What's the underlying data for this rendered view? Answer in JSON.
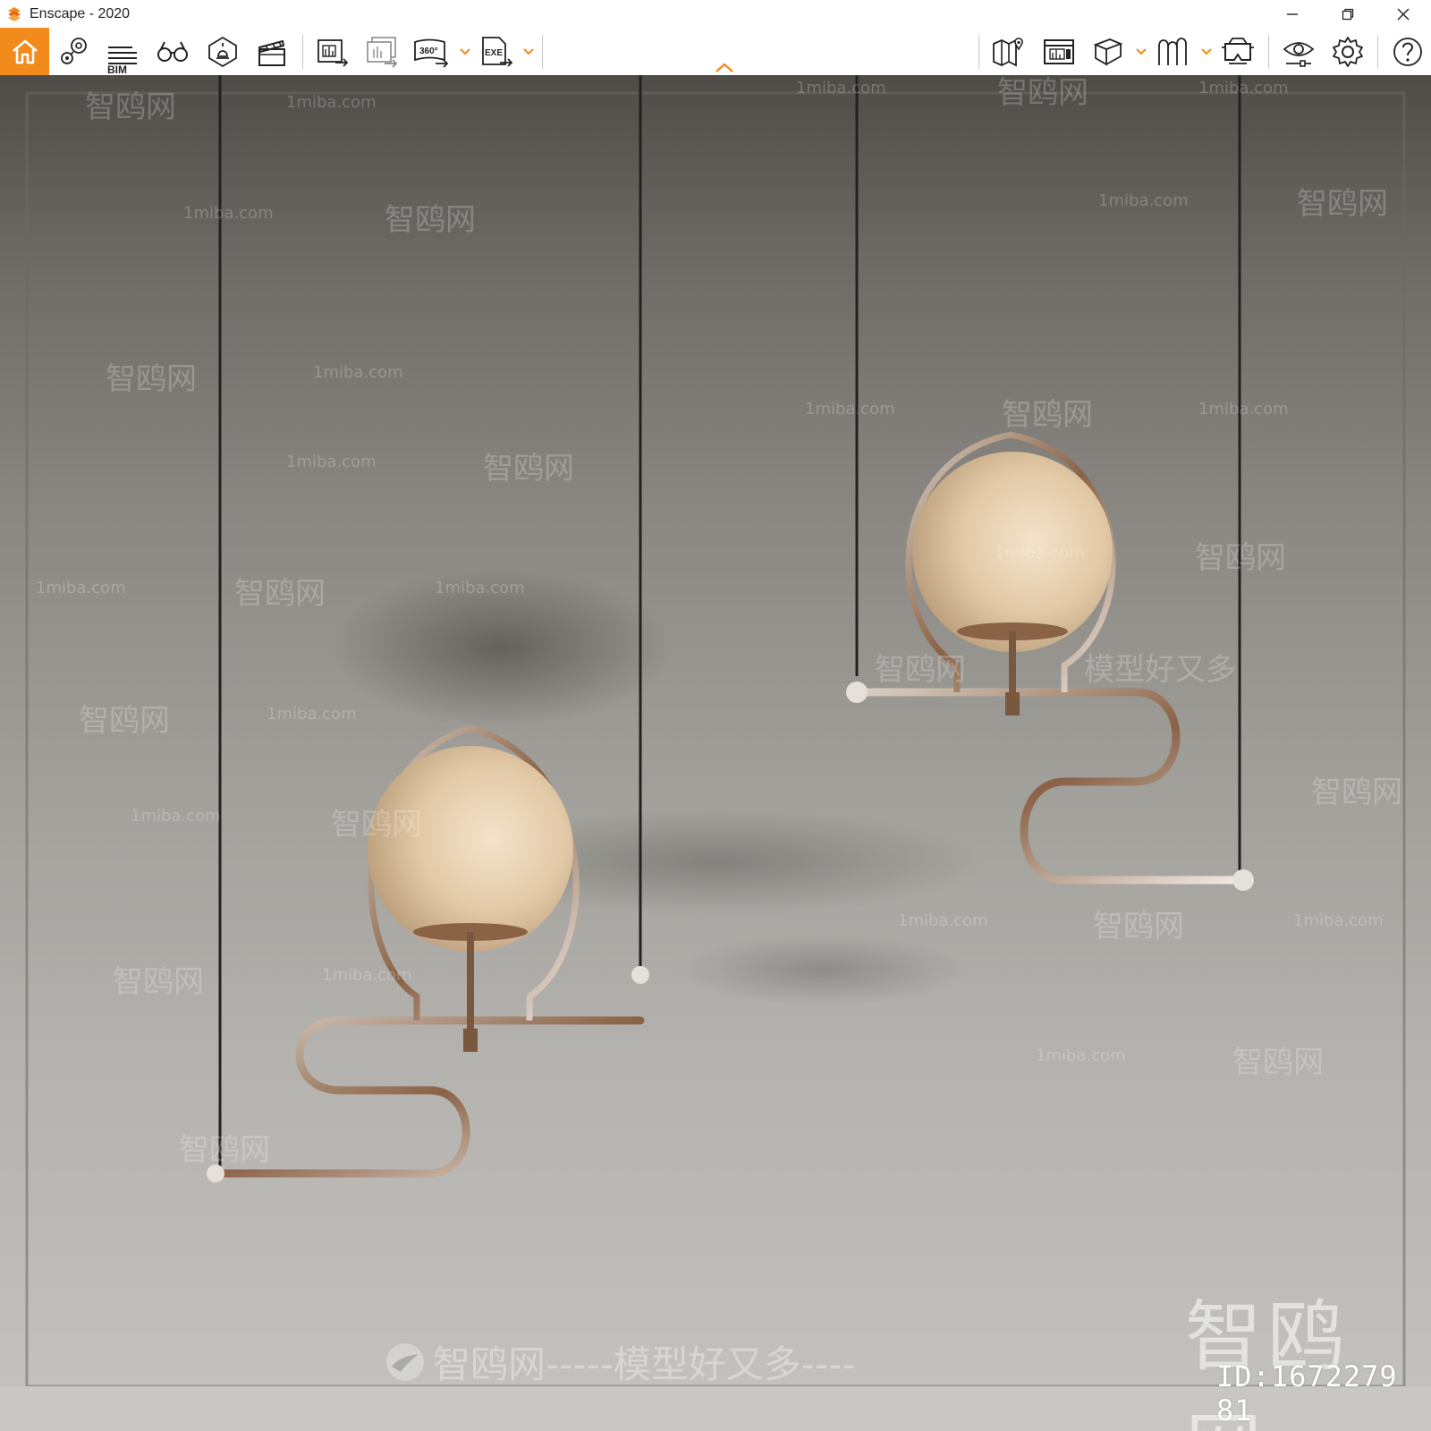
{
  "window": {
    "title": "Enscape - 2020",
    "accent_color": "#f28a1c",
    "controls": [
      "minimize-icon",
      "restore-icon",
      "close-icon"
    ]
  },
  "toolbar": {
    "bim_label": "BIM",
    "left_tools": [
      "home-icon",
      "location-pin-icon",
      "bim-list-icon",
      "binoculars-icon",
      "light-view-icon",
      "video-clapper-icon",
      "export-image-icon",
      "batch-export-icon",
      "export-360-icon",
      "export-exe-icon"
    ],
    "right_tools": [
      "map-icon",
      "asset-library-icon",
      "cube-view-icon",
      "sketch-mode-icon",
      "vr-headset-icon",
      "visual-settings-icon",
      "settings-gear-icon",
      "help-icon"
    ],
    "export_360_label": "360°",
    "export_exe_label": "EXE"
  },
  "scene": {
    "watermark_site": "1miba.com",
    "watermark_brand": "智鸥网",
    "watermark_slogan": "模型好又多",
    "watermark_bottom": "智鸥网-----模型好又多----",
    "watermark_logo": "智鸥网",
    "id_label": "ID:1672279​81"
  }
}
